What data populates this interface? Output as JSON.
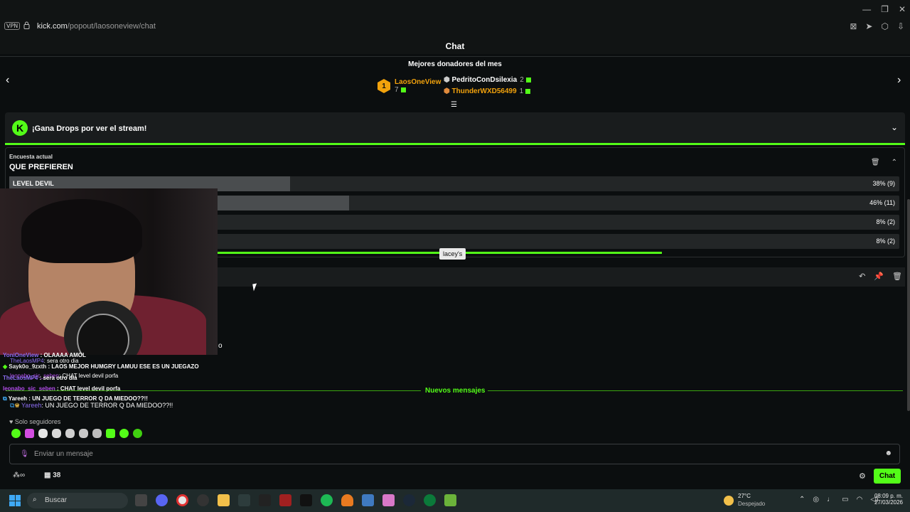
{
  "browser": {
    "vpn": "VPN",
    "url_host": "kick.com",
    "url_path": "/popout/laosoneview/chat",
    "win_minimize": "—",
    "win_restore": "❐",
    "win_close": "✕"
  },
  "chat_header": {
    "title": "Chat"
  },
  "donors": {
    "title": "Mejores donadores del mes",
    "first": {
      "rank": "1",
      "name": "LaosOneView",
      "count": "7"
    },
    "second": {
      "name": "PedritoConDsilexia",
      "count": "2"
    },
    "third": {
      "name": "ThunderWXD56499",
      "count": "1"
    }
  },
  "drops": {
    "logo": "K",
    "text": "¡Gana Drops por ver el stream!"
  },
  "poll": {
    "label": "Encuesta actual",
    "question": "QUE PREFIEREN",
    "options": [
      {
        "name": "LEVEL DEVIL",
        "percent_text": "38% (9)",
        "percent": 38
      },
      {
        "name": "",
        "percent_text": "46% (11)",
        "percent": 46
      },
      {
        "name": "",
        "percent_text": "8% (2)",
        "percent": 8
      },
      {
        "name": "",
        "percent_text": "8% (2)",
        "percent": 8
      }
    ],
    "time_remaining_fraction": 0.73
  },
  "tooltip": "lacey's",
  "stray_char": "o",
  "messages": [
    {
      "user": "YoniOneView",
      "sep": " : ",
      "text": "OLAAAA AMOL",
      "user_color": "#8b6cf0"
    },
    {
      "user": "TheLaosMP4",
      "sep": ": ",
      "text": "sera otro dia",
      "user_color": "#8b6cf0"
    },
    {
      "user": "Sayk0o_9zxth",
      "sep": " : ",
      "text": "LAOS MEJOR HUMGRY LAMUU ESE ES UN JUEGAZO",
      "user_color": "#e8e8e8"
    },
    {
      "user": "leonabo_sic_seben",
      "sep": ": ",
      "text": "CHAT level devil porfa",
      "user_color": "#b14ee8"
    },
    {
      "user": "TheLaosMP4",
      "sep": " : ",
      "text": "sera otro dia",
      "user_color": "#8b6cf0"
    },
    {
      "user": "leonabo_sic_seben",
      "sep": " : ",
      "text": "CHAT level devil porfa",
      "user_color": "#b14ee8"
    },
    {
      "user": "Yareeh",
      "sep": " : ",
      "text": "UN JUEGO DE TERROR Q DA MIEDOO??!!",
      "user_color": "#ffffff"
    },
    {
      "user": "Yareeh",
      "sep": ": ",
      "text": "UN JUEGO DE TERROR Q DA MIEDOO??!!",
      "user_color": "#8b6cf0"
    }
  ],
  "new_messages": "Nuevos mensajes",
  "chat_mode": "Solo seguidores",
  "input": {
    "placeholder": "Enviar un mensaje"
  },
  "bottom": {
    "points": "38",
    "chat_button": "Chat"
  },
  "taskbar": {
    "search": "Buscar",
    "temperature": "27°C",
    "weather": "Despejado",
    "time": "08:09 p. m.",
    "date": "27/03/2026"
  },
  "colors": {
    "kick_green": "#53fc18",
    "gold": "#f2a20c",
    "background": "#0b0e0f"
  }
}
